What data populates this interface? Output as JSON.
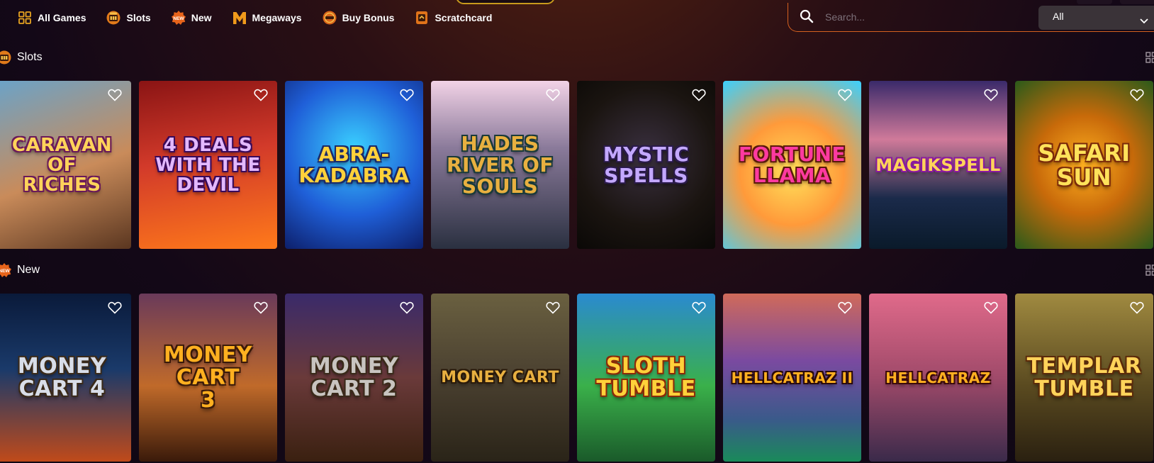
{
  "nav": {
    "items": [
      {
        "label": "All Games",
        "icon": "grid-icon"
      },
      {
        "label": "Slots",
        "icon": "slot-machine-icon"
      },
      {
        "label": "New",
        "icon": "new-badge-icon"
      },
      {
        "label": "Megaways",
        "icon": "megaways-m-icon"
      },
      {
        "label": "Buy Bonus",
        "icon": "bonus-coin-icon"
      },
      {
        "label": "Scratchcard",
        "icon": "scratchcard-icon"
      }
    ]
  },
  "search": {
    "placeholder": "Search...",
    "value": "",
    "filter_value": "All"
  },
  "sections": {
    "slots": {
      "label": "Slots",
      "games": [
        {
          "title": "Caravan\nof\nRiches"
        },
        {
          "title": "4 Deals\nwith the\nDevil"
        },
        {
          "title": "Abra-\nkadabra"
        },
        {
          "title": "Hades\nRiver of Souls"
        },
        {
          "title": "Mystic\nSpells"
        },
        {
          "title": "Fortune\nLlama"
        },
        {
          "title": "MagikSpell"
        },
        {
          "title": "Safari\nSun"
        }
      ]
    },
    "new": {
      "label": "New",
      "games": [
        {
          "title": "Money\nCart 4"
        },
        {
          "title": "Money\nCart\n3"
        },
        {
          "title": "Money\nCart 2"
        },
        {
          "title": "Money Cart"
        },
        {
          "title": "Sloth\nTumble"
        },
        {
          "title": "Hellcatraz II"
        },
        {
          "title": "Hellcatraz"
        },
        {
          "title": "Templar\nTumble"
        }
      ]
    }
  },
  "colors": {
    "accent_orange": "#d5611f",
    "gold": "#e7a321",
    "background": "#130817"
  }
}
